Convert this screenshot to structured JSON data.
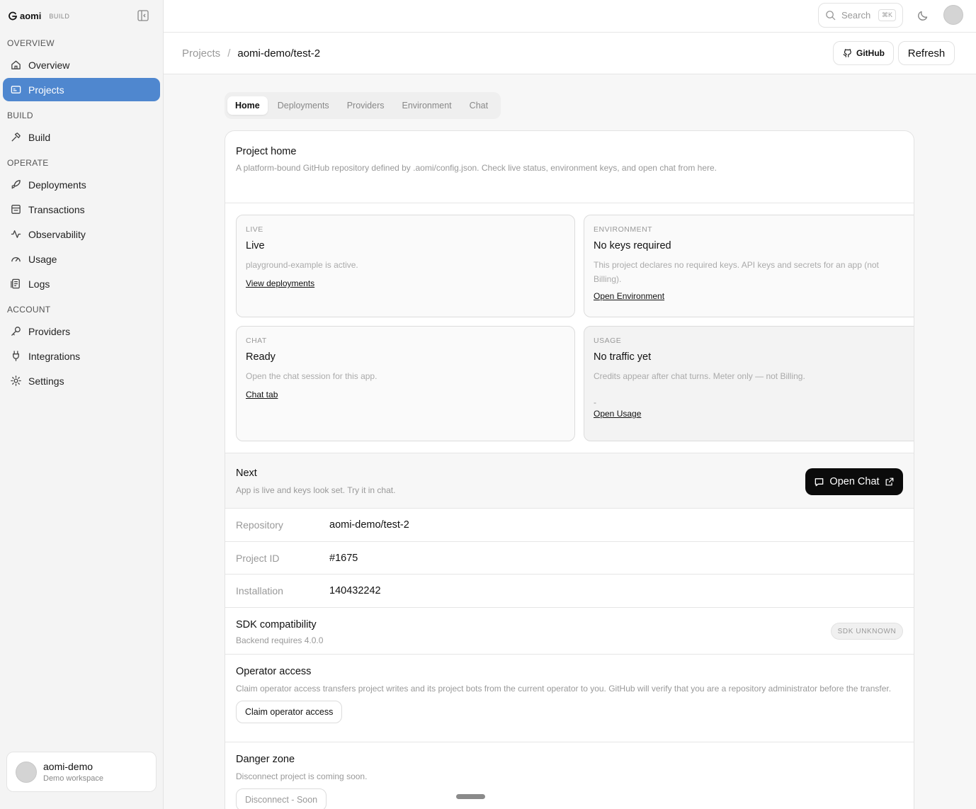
{
  "app": {
    "brand": "aomi",
    "build_tag": "BUILD"
  },
  "sidebar": {
    "sections": [
      {
        "title": "OVERVIEW",
        "items": [
          {
            "label": "Overview",
            "icon": "home-icon"
          },
          {
            "label": "Projects",
            "icon": "folder-icon",
            "active": true
          }
        ]
      },
      {
        "title": "BUILD",
        "items": [
          {
            "label": "Build",
            "icon": "hammer-icon"
          }
        ]
      },
      {
        "title": "OPERATE",
        "items": [
          {
            "label": "Deployments",
            "icon": "rocket-icon"
          },
          {
            "label": "Transactions",
            "icon": "receipt-icon"
          },
          {
            "label": "Observability",
            "icon": "activity-icon"
          },
          {
            "label": "Usage",
            "icon": "gauge-icon"
          },
          {
            "label": "Logs",
            "icon": "logs-icon"
          }
        ]
      },
      {
        "title": "ACCOUNT",
        "items": [
          {
            "label": "Providers",
            "icon": "key-icon"
          },
          {
            "label": "Integrations",
            "icon": "plug-icon"
          },
          {
            "label": "Settings",
            "icon": "gear-icon"
          }
        ]
      }
    ],
    "workspace": {
      "name": "aomi-demo",
      "subtitle": "Demo workspace"
    }
  },
  "topbar": {
    "search_label": "Search",
    "search_shortcut": "⌘K"
  },
  "header": {
    "breadcrumb": {
      "parent": "Projects",
      "separator": "/",
      "current": "aomi-demo/test-2"
    },
    "github_label": "GitHub",
    "refresh_label": "Refresh"
  },
  "tabs": [
    {
      "label": "Home",
      "active": true
    },
    {
      "label": "Deployments"
    },
    {
      "label": "Providers"
    },
    {
      "label": "Environment"
    },
    {
      "label": "Chat"
    }
  ],
  "project_home": {
    "title": "Project home",
    "description": "A platform-bound GitHub repository defined by .aomi/config.json. Check live status, environment keys, and open chat from here."
  },
  "tiles": {
    "live": {
      "tag": "LIVE",
      "title": "Live",
      "desc": "playground-example is active.",
      "link": "View deployments"
    },
    "environment": {
      "tag": "ENVIRONMENT",
      "title": "No keys required",
      "desc": "This project declares no required keys. API keys and secrets for an app (not Billing).",
      "link": "Open Environment"
    },
    "chat": {
      "tag": "CHAT",
      "title": "Ready",
      "desc": "Open the chat session for this app.",
      "link": "Chat tab"
    },
    "usage": {
      "tag": "USAGE",
      "title": "No traffic yet",
      "desc": "Credits appear after chat turns. Meter only — not Billing.",
      "value": "-",
      "link": "Open Usage"
    }
  },
  "next": {
    "title": "Next",
    "desc": "App is live and keys look set. Try it in chat.",
    "button": "Open Chat"
  },
  "details": [
    {
      "key": "Repository",
      "value": "aomi-demo/test-2"
    },
    {
      "key": "Project ID",
      "value": "#1675"
    },
    {
      "key": "Installation",
      "value": "140432242"
    }
  ],
  "sdk": {
    "title": "SDK compatibility",
    "desc": "Backend requires 4.0.0",
    "badge": "SDK UNKNOWN"
  },
  "operator": {
    "title": "Operator access",
    "desc": "Claim operator access transfers project writes and its project bots from the current operator to you. GitHub will verify that you are a repository administrator before the transfer.",
    "button": "Claim operator access"
  },
  "danger": {
    "title": "Danger zone",
    "desc": "Disconnect project is coming soon.",
    "button": "Disconnect - Soon"
  }
}
